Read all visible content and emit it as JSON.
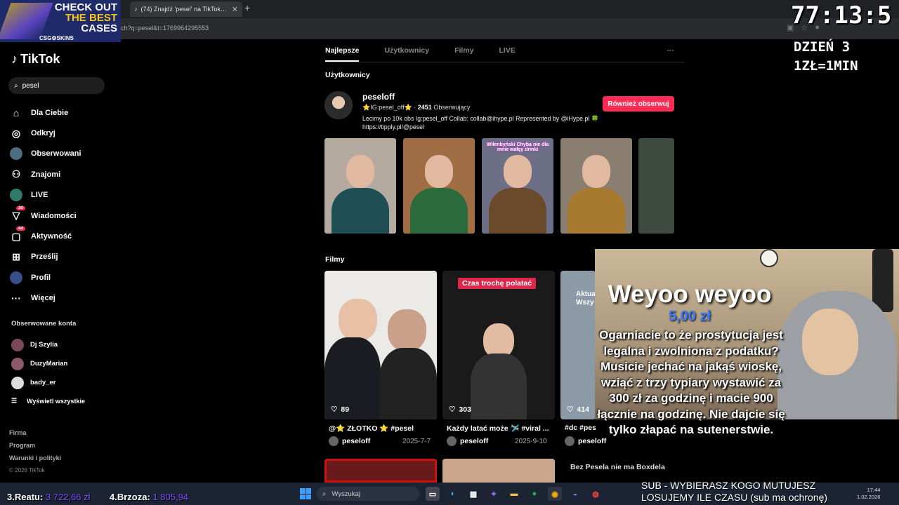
{
  "browser": {
    "tab_title": "(74) Znajdź 'pesel' na TikTok | W",
    "url": "ch?q=pesel&t=1769964295553"
  },
  "promo": {
    "line1": "CHECK OUT",
    "line2": "THE BEST",
    "line3": "CASES",
    "brand": "CSG⚙SKINS"
  },
  "tiktok": {
    "logo": "TikTok",
    "search_value": "pesel",
    "nav": [
      {
        "label": "Dla Ciebie",
        "icon": "home-icon"
      },
      {
        "label": "Odkryj",
        "icon": "compass-icon"
      },
      {
        "label": "Obserwowani",
        "icon": "avatar"
      },
      {
        "label": "Znajomi",
        "icon": "friends-icon"
      },
      {
        "label": "LIVE",
        "icon": "live-icon"
      },
      {
        "label": "Wiadomości",
        "icon": "messages-icon",
        "badge": "30"
      },
      {
        "label": "Aktywność",
        "icon": "activity-icon",
        "badge": "44"
      },
      {
        "label": "Prześlij",
        "icon": "upload-icon"
      },
      {
        "label": "Profil",
        "icon": "profile-icon"
      },
      {
        "label": "Więcej",
        "icon": "more-icon"
      }
    ],
    "followed_title": "Obserwowane konta",
    "followed": [
      "Dj Szylia",
      "DuzyMarian",
      "bady_er"
    ],
    "see_all": "Wyświetl wszystkie",
    "footer": [
      "Firma",
      "Program",
      "Warunki i polityki"
    ],
    "copyright": "© 2026 TikTok"
  },
  "tabs": [
    "Najlepsze",
    "Użytkownicy",
    "Filmy",
    "LIVE"
  ],
  "tabs_more": "···",
  "users_section": "Użytkownicy",
  "user": {
    "name": "peseloff",
    "handle_line": "⭐IG:pesel_off⭐ · ",
    "followers": "2451",
    "followers_label": " Obserwujący",
    "desc": "Lecimy po 10k obs Ig:pesel_off Collab: collab@ihype.pl Represented by @iHype.pl 🍀 https://tipply.pl/@pesel",
    "follow_btn": "Również obserwuj"
  },
  "thumb_captions": [
    "",
    "",
    "Wiłenbyński Chyba nie dla mnie wałęy drinki",
    "",
    ""
  ],
  "films_section": "Filmy",
  "videos": [
    {
      "likes": "89",
      "title": "@⭐ ZŁOTKO ⭐ #pesel",
      "author": "peseloff",
      "date": "2025-7-7",
      "tag": ""
    },
    {
      "likes": "303",
      "title": "Każdy latać może 🛩️ #viral ...",
      "author": "peseloff",
      "date": "2025-9-10",
      "tag": "Czas trochę polatać"
    },
    {
      "likes": "414",
      "title": "#dc #pesel",
      "author": "peseloff",
      "date": "",
      "tag": "Aktua Wszy"
    }
  ],
  "row3_caption": "Bez Pesela nie ma Boxdela",
  "stream": {
    "timer": "77:13:5",
    "day": "DZIEŃ 3",
    "rate": "1ZŁ=1MIN",
    "alert_title": "Weyoo weyoo",
    "alert_amount": "5,00 zł",
    "alert_message": "Ogarniacie to że prostytucja jest legalna i zwolniona z podatku? Musicie jechać na jakąś wioskę, wziąć z trzy typiary wystawić za 300 zł za godzinę i macie 900 łącznie na godzinę. Nie dajcie się tylko złapać na sutenerstwie.",
    "stat1_label": "3.Reatu:",
    "stat1_value": "3 722,66 zł",
    "stat2_label": "4.Brzoza:",
    "stat2_value": "1 805,94",
    "sub_line1": "SUB - WYBIERASZ KOGO MUTUJESZ",
    "sub_line2": "LOSUJEMY ILE CZASU (sub ma ochronę)"
  },
  "taskbar": {
    "search": "Wyszukaj",
    "time": "17:44",
    "date": "1.02.2026"
  },
  "colors": {
    "accent": "#fe2c55",
    "stat_value": "#7b4cff",
    "amount": "#3a7bff"
  }
}
